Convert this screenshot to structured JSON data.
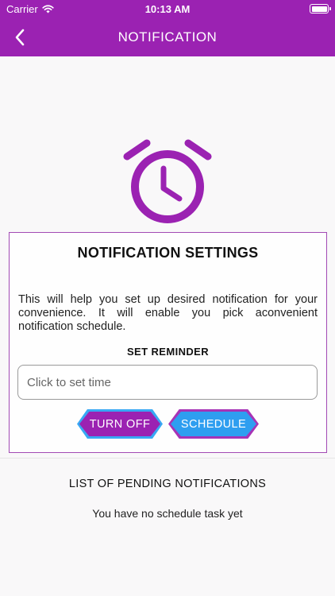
{
  "status_bar": {
    "carrier": "Carrier",
    "time": "10:13 AM"
  },
  "nav": {
    "title": "NOTIFICATION",
    "back_icon": "chevron-left-icon"
  },
  "hero_icon": "alarm-clock-icon",
  "settings": {
    "title": "NOTIFICATION SETTINGS",
    "description": "This will help you set up desired notification for your convenience. It will enable you pick aconvenient notification schedule.",
    "reminder_label": "SET REMINDER",
    "time_input": {
      "value": "",
      "placeholder": "Click to set time"
    },
    "turn_off_label": "TURN OFF",
    "schedule_label": "SCHEDULE"
  },
  "pending": {
    "title": "LIST OF PENDING NOTIFICATIONS",
    "empty_message": "You have no schedule task yet"
  },
  "colors": {
    "primary": "#9b22b2",
    "accent_blue": "#2e9ef0",
    "card_border": "#a24ab4"
  }
}
